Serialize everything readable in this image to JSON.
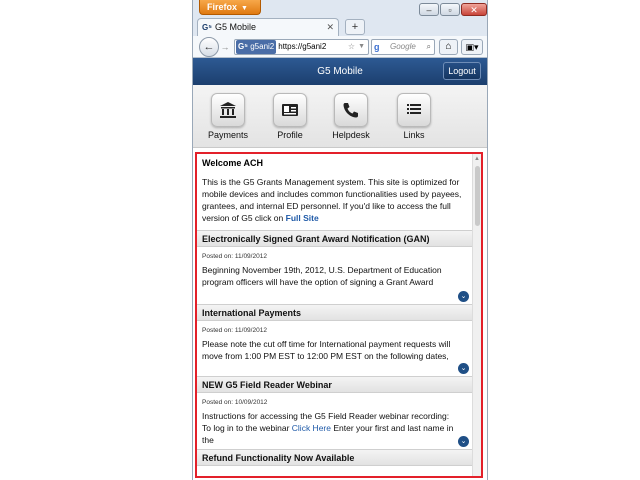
{
  "browser": {
    "menu_button": "Firefox",
    "tab_title": "G5 Mobile",
    "new_tab_symbol": "+",
    "url_identity": "g5ani2",
    "url_text": "https://g5ani2",
    "search_placeholder": "Google"
  },
  "app": {
    "title": "G5 Mobile",
    "logout_label": "Logout",
    "nav": [
      {
        "label": "Payments",
        "icon": "bank-icon"
      },
      {
        "label": "Profile",
        "icon": "id-card-icon"
      },
      {
        "label": "Helpdesk",
        "icon": "phone-icon"
      },
      {
        "label": "Links",
        "icon": "list-icon"
      }
    ]
  },
  "welcome": {
    "heading": "Welcome ACH",
    "body": "This is the G5 Grants Management system. This site is optimized for mobile devices and includes common functionalities used by payees, grantees, and internal ED personnel. If you'd like to access the full version of G5 click on ",
    "link": "Full Site"
  },
  "news": [
    {
      "title": "Electronically Signed Grant Award Notification (GAN)",
      "posted": "Posted on: 11/09/2012",
      "body": "Beginning November 19th, 2012, U.S. Department of Education program officers will have the option of signing a Grant Award"
    },
    {
      "title": "International Payments",
      "posted": "Posted on: 11/09/2012",
      "body": "Please note the cut off time for International payment requests will move from 1:00 PM EST to 12:00 PM EST on the following dates,"
    },
    {
      "title": "NEW G5 Field Reader Webinar",
      "posted": "Posted on: 10/09/2012",
      "body_before_link": "Instructions for accessing the G5 Field Reader webinar recording: To log in to the webinar ",
      "link": "Click Here",
      "body_after_link": " Enter your first and last name in the"
    },
    {
      "title": "Refund Functionality Now Available"
    }
  ],
  "colors": {
    "header": "#1c3f6e",
    "highlight_border": "#e3202a",
    "link": "#1f5aa8"
  }
}
